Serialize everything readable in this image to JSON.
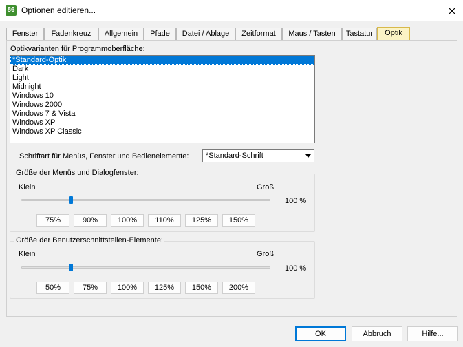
{
  "window": {
    "app_icon_text": "86",
    "title": "Optionen editieren...",
    "close_icon": "close-icon"
  },
  "tabs": [
    {
      "label": "Fenster",
      "active": false
    },
    {
      "label": "Fadenkreuz",
      "active": false
    },
    {
      "label": "Allgemein",
      "active": false
    },
    {
      "label": "Pfade",
      "active": false
    },
    {
      "label": "Datei / Ablage",
      "active": false
    },
    {
      "label": "Zeitformat",
      "active": false
    },
    {
      "label": "Maus / Tasten",
      "active": false
    },
    {
      "label": "Tastatur",
      "active": false
    },
    {
      "label": "Optik",
      "active": true
    }
  ],
  "optik": {
    "list_label": "Optikvarianten für Programmoberfläche:",
    "variants": [
      "*Standard-Optik",
      "Dark",
      "Light",
      "Midnight",
      "Windows 10",
      "Windows 2000",
      "Windows 7 & Vista",
      "Windows XP",
      "Windows XP Classic"
    ],
    "selected_index": 0,
    "font_label": "Schriftart für Menüs, Fenster und Bedienelemente:",
    "font_value": "*Standard-Schrift"
  },
  "menus_group": {
    "caption": "Größe der Menüs und Dialogfenster:",
    "min_label": "Klein",
    "max_label": "Groß",
    "value_text": "100 %",
    "slider_fraction": 0.2,
    "buttons": [
      "75%",
      "90%",
      "100%",
      "110%",
      "125%",
      "150%"
    ]
  },
  "ui_group": {
    "caption": "Größe der Benutzerschnittstellen-Elemente:",
    "min_label": "Klein",
    "max_label": "Groß",
    "value_text": "100 %",
    "slider_fraction": 0.2,
    "buttons": [
      "50%",
      "75%",
      "100%",
      "125%",
      "150%",
      "200%"
    ]
  },
  "footer": {
    "ok_label": "OK",
    "cancel_label": "Abbruch",
    "help_label": "Hilfe..."
  },
  "colors": {
    "selection": "#0078d7",
    "active_tab": "#fbf3c5",
    "app_icon": "#3f8f2f"
  }
}
